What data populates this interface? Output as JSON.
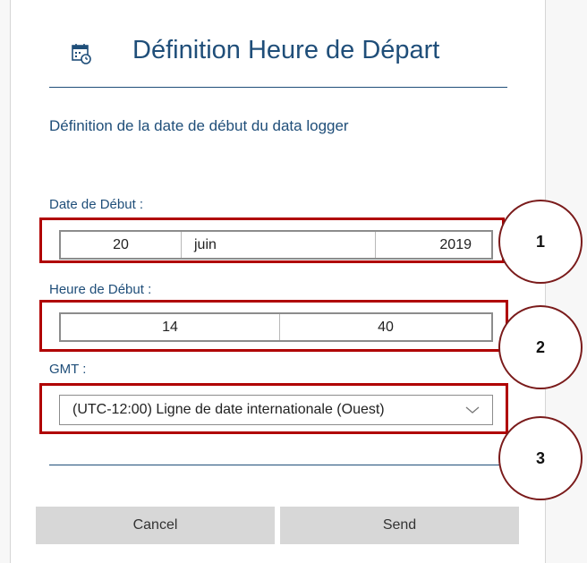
{
  "dialog": {
    "title": "Définition Heure de Départ",
    "subtitle": "Définition de la date de début du data logger",
    "accent_color": "#1f4e79",
    "header_icon": "calendar-clock-icon"
  },
  "start_date": {
    "label": "Date de Début :",
    "day": "20",
    "month": "juin",
    "year": "2019"
  },
  "start_time": {
    "label": "Heure de Début :",
    "hour": "14",
    "minute": "40"
  },
  "gmt": {
    "label": "GMT :",
    "selected": "(UTC-12:00) Ligne de date internationale (Ouest)"
  },
  "buttons": {
    "cancel": "Cancel",
    "send": "Send"
  },
  "callouts": [
    "1",
    "2",
    "3"
  ],
  "highlight_color": "#b00000"
}
